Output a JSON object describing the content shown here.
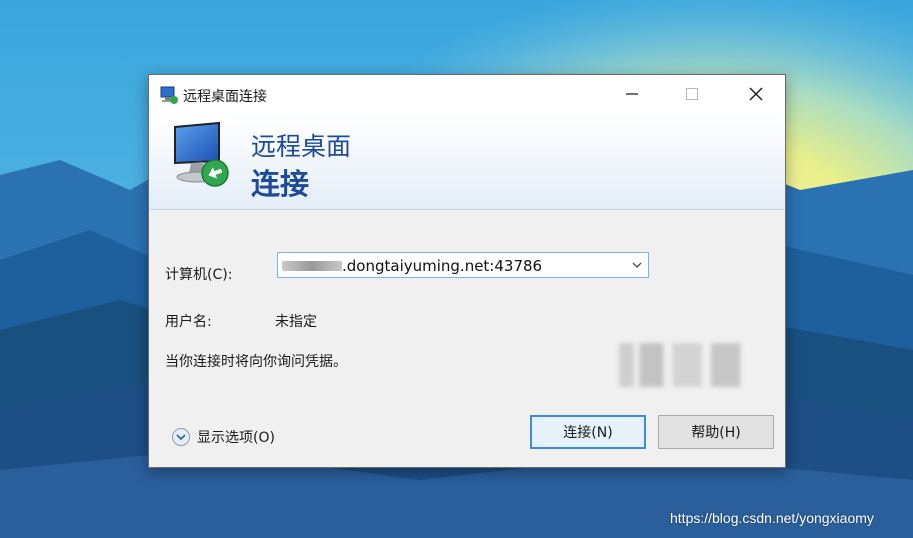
{
  "window": {
    "title": "远程桌面连接",
    "icon": "remote-desktop-icon"
  },
  "banner": {
    "line1": "远程桌面",
    "line2": "连接"
  },
  "form": {
    "computer_label": "计算机(C):",
    "computer_value": ".dongtaiyuming.net:43786",
    "user_label": "用户名:",
    "user_value": "未指定",
    "info_text": "当你连接时将向你询问凭据。"
  },
  "footer": {
    "options_label": "显示选项(O)",
    "connect_label": "连接(N)",
    "help_label": "帮助(H)"
  },
  "watermark": "https://blog.csdn.net/yongxiaomy",
  "colors": {
    "accent": "#1e4a9a",
    "focus_border": "#3c8de0"
  }
}
